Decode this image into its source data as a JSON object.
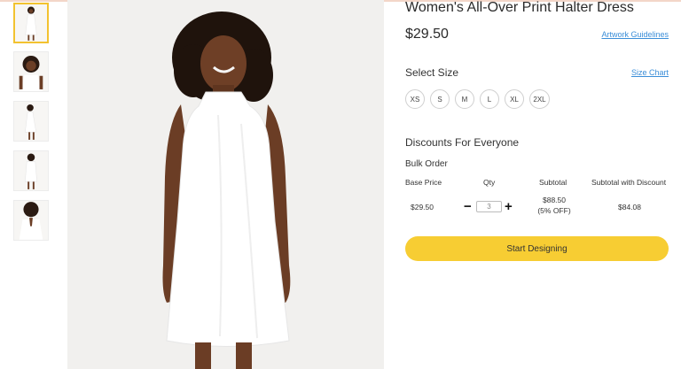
{
  "product": {
    "title": "Women's All-Over Print Halter Dress",
    "price": "$29.50",
    "artwork_link": "Artwork Guidelines"
  },
  "size": {
    "label": "Select Size",
    "chart_link": "Size Chart",
    "options": [
      "XS",
      "S",
      "M",
      "L",
      "XL",
      "2XL"
    ]
  },
  "discounts": {
    "title": "Discounts For Everyone",
    "bulk_label": "Bulk Order",
    "headers": {
      "base_price": "Base Price",
      "qty": "Qty",
      "subtotal": "Subtotal",
      "subtotal_discount": "Subtotal with Discount"
    },
    "row": {
      "base_price": "$29.50",
      "qty_value": "3",
      "minus": "−",
      "plus": "+",
      "subtotal": "$88.50",
      "subtotal_note": "(5% OFF)",
      "subtotal_discount": "$84.08"
    }
  },
  "cta": {
    "label": "Start Designing"
  },
  "colors": {
    "accent": "#f7cd33",
    "link": "#3b8ed8",
    "thumb_active_border": "#f2c230"
  }
}
